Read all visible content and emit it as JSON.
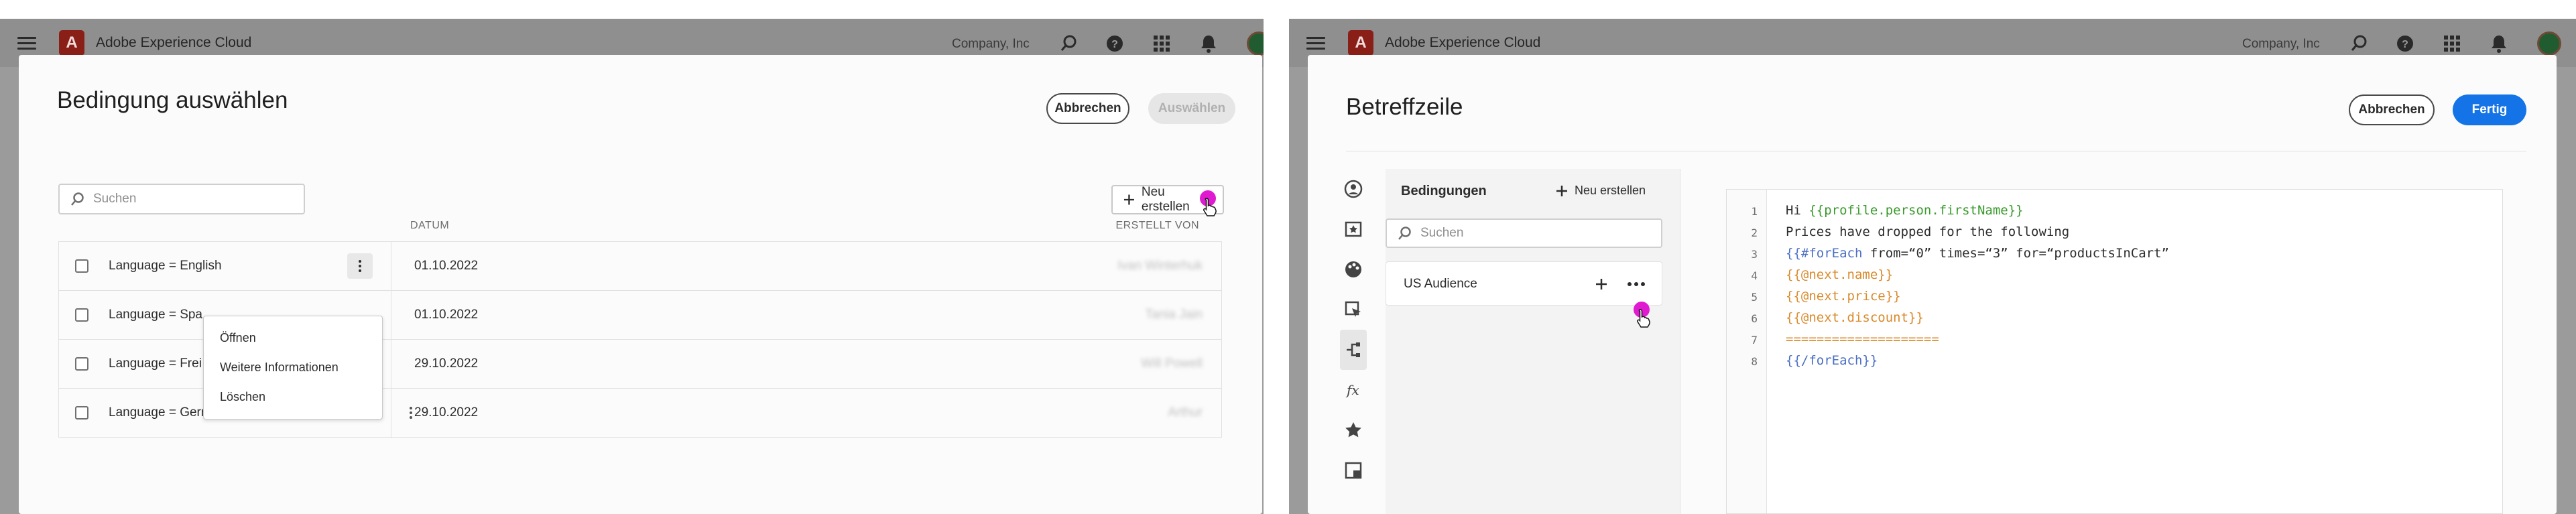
{
  "app": {
    "title": "Adobe Experience Cloud",
    "company": "Company, Inc",
    "menu_icon": "hamburger-menu-icon",
    "logo_icon": "adobe-logo-icon",
    "topbar_icons": [
      "search-icon",
      "help-icon",
      "apps-grid-icon",
      "bell-icon",
      "avatar"
    ]
  },
  "left_dialog": {
    "title": "Bedingung auswählen",
    "cancel_label": "Abbrechen",
    "select_label": "Auswählen",
    "search_placeholder": "Suchen",
    "new_button_label": "Neu erstellen",
    "columns": {
      "date": "DATUM",
      "created_by": "ERSTELLT VON"
    },
    "rows": [
      {
        "condition": "Language =  English",
        "date": "01.10.2022",
        "author": "Ivan Winterhuk"
      },
      {
        "condition": "Language =  Spa",
        "date": "01.10.2022",
        "author": "Tania Jain"
      },
      {
        "condition": "Language =  Frei",
        "date": "29.10.2022",
        "author": "Will  Powell"
      },
      {
        "condition": "Language = German",
        "date": "29.10.2022",
        "author": "Arthur"
      }
    ],
    "context_menu": [
      "Öffnen",
      "Weitere Informationen",
      "Löschen"
    ]
  },
  "right_dialog": {
    "title": "Betreffzeile",
    "cancel_label": "Abbrechen",
    "done_label": "Fertig",
    "sidebar_icons": [
      "profile-icon",
      "star-badge-icon",
      "palette-icon",
      "cursor-click-icon",
      "conditions-icon",
      "function-icon",
      "star-icon",
      "panel-icon"
    ],
    "conditions_heading": "Bedingungen",
    "new_button_label": "Neu erstellen",
    "search_placeholder": "Suchen",
    "condition_item": "US Audience",
    "code_lines": [
      {
        "n": "1",
        "parts": [
          {
            "t": "Hi ",
            "c": "plain"
          },
          {
            "t": "{{profile.person.firstName}}",
            "c": "green"
          }
        ]
      },
      {
        "n": "2",
        "parts": [
          {
            "t": "Prices have dropped for the following",
            "c": "plain"
          }
        ]
      },
      {
        "n": "3",
        "parts": [
          {
            "t": "{{#forEach ",
            "c": "blue"
          },
          {
            "t": "from=“0” times=“3” for=“productsInCart”",
            "c": "plain"
          }
        ]
      },
      {
        "n": "4",
        "parts": [
          {
            "t": "{{@next.name}}",
            "c": "orange"
          }
        ]
      },
      {
        "n": "5",
        "parts": [
          {
            "t": "{{@next.price}}",
            "c": "orange"
          }
        ]
      },
      {
        "n": "6",
        "parts": [
          {
            "t": "{{@next.discount}}",
            "c": "orange"
          }
        ]
      },
      {
        "n": "7",
        "parts": [
          {
            "t": "====================",
            "c": "orange"
          }
        ]
      },
      {
        "n": "8",
        "parts": [
          {
            "t": "{{/forEach}}",
            "c": "blue"
          }
        ]
      }
    ]
  }
}
